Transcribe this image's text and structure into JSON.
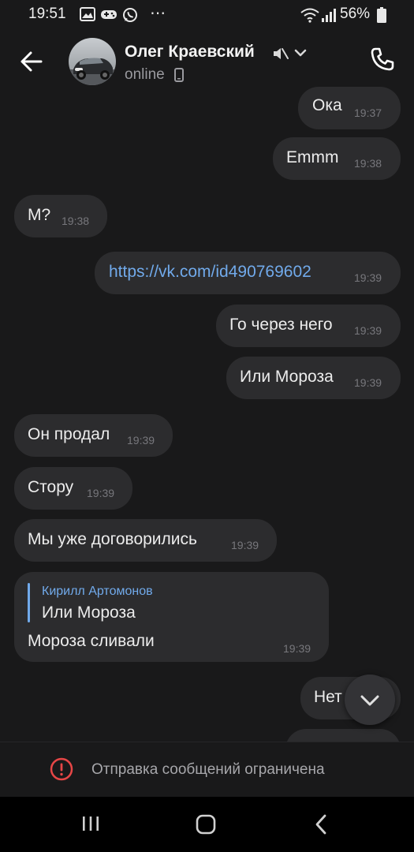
{
  "status_bar": {
    "time": "19:51",
    "battery": "56%",
    "more": "⋯"
  },
  "header": {
    "contact_name": "Олег Краевский",
    "status": "online"
  },
  "messages": [
    {
      "text": "Ока",
      "time": "19:37",
      "outgoing": true
    },
    {
      "text": "Emmm",
      "time": "19:38",
      "outgoing": true
    },
    {
      "text": "М?",
      "time": "19:38",
      "outgoing": false
    },
    {
      "text": "https://vk.com/id490769602",
      "time": "19:39",
      "outgoing": true,
      "is_link": true
    },
    {
      "text": "Го через него",
      "time": "19:39",
      "outgoing": true
    },
    {
      "text": "Или Мороза",
      "time": "19:39",
      "outgoing": true
    },
    {
      "text": "Он продал",
      "time": "19:39",
      "outgoing": false
    },
    {
      "text": "Стору",
      "time": "19:39",
      "outgoing": false
    },
    {
      "text": "Мы уже договорились",
      "time": "19:39",
      "outgoing": false
    }
  ],
  "reply_message": {
    "author": "Кирилл Артомонов",
    "quote": "Или Мороза",
    "text": "Мороза сливали",
    "time": "19:39"
  },
  "last_message": {
    "text": "Нет",
    "outgoing": true
  },
  "restriction_notice": "Отправка сообщений ограничена",
  "colors": {
    "background": "#19191a",
    "bubble": "#2c2c2e",
    "accent_link": "#71aaeb",
    "warning_red": "#e64646"
  },
  "icons": {
    "back": "arrow-left-icon",
    "mute": "speaker-muted-icon",
    "dropdown": "chevron-down-icon",
    "call": "phone-icon",
    "scroll_down": "chevron-down-icon",
    "warning": "exclamation-circle-icon",
    "nav_recent": "recent-apps-icon",
    "nav_home": "home-icon",
    "nav_back": "nav-back-icon"
  }
}
